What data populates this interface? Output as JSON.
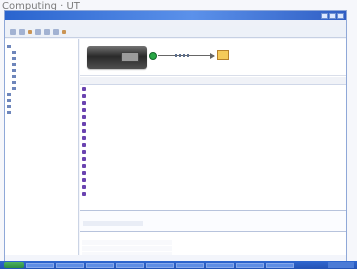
{
  "page": {
    "caption": "Computing · UT"
  },
  "window": {
    "title": ""
  },
  "menubar": {
    "label": ""
  },
  "tree": {
    "items": [
      {
        "label": ""
      },
      {
        "label": ""
      },
      {
        "label": ""
      },
      {
        "label": ""
      },
      {
        "label": ""
      },
      {
        "label": ""
      },
      {
        "label": ""
      },
      {
        "label": ""
      },
      {
        "label": ""
      },
      {
        "label": ""
      },
      {
        "label": ""
      },
      {
        "label": ""
      }
    ]
  },
  "header": {
    "device_label": "",
    "target_label": ""
  },
  "table": {
    "columns": [
      "",
      "",
      "",
      ""
    ],
    "rows": [
      {
        "c1": "",
        "c2": "",
        "c3": "",
        "c4": ""
      },
      {
        "c1": "",
        "c2": "",
        "c3": "",
        "c4": ""
      },
      {
        "c1": "",
        "c2": "",
        "c3": "",
        "c4": ""
      },
      {
        "c1": "",
        "c2": "",
        "c3": "",
        "c4": ""
      },
      {
        "c1": "",
        "c2": "",
        "c3": "",
        "c4": ""
      },
      {
        "c1": "",
        "c2": "",
        "c3": "",
        "c4": ""
      },
      {
        "c1": "",
        "c2": "",
        "c3": "",
        "c4": ""
      },
      {
        "c1": "",
        "c2": "",
        "c3": "",
        "c4": ""
      },
      {
        "c1": "",
        "c2": "",
        "c3": "",
        "c4": ""
      },
      {
        "c1": "",
        "c2": "",
        "c3": "",
        "c4": ""
      },
      {
        "c1": "",
        "c2": "",
        "c3": "",
        "c4": ""
      },
      {
        "c1": "",
        "c2": "",
        "c3": "",
        "c4": ""
      },
      {
        "c1": "",
        "c2": "",
        "c3": "",
        "c4": ""
      },
      {
        "c1": "",
        "c2": "",
        "c3": "",
        "c4": ""
      },
      {
        "c1": "",
        "c2": "",
        "c3": "",
        "c4": ""
      },
      {
        "c1": "",
        "c2": "",
        "c3": "",
        "c4": ""
      }
    ]
  },
  "details": {
    "title_left": "",
    "title_right": ""
  },
  "extra": {
    "title_left": "",
    "title_right": ""
  },
  "taskbar": {
    "start_label": "",
    "items": [
      "",
      "",
      "",
      "",
      "",
      "",
      "",
      "",
      ""
    ]
  }
}
